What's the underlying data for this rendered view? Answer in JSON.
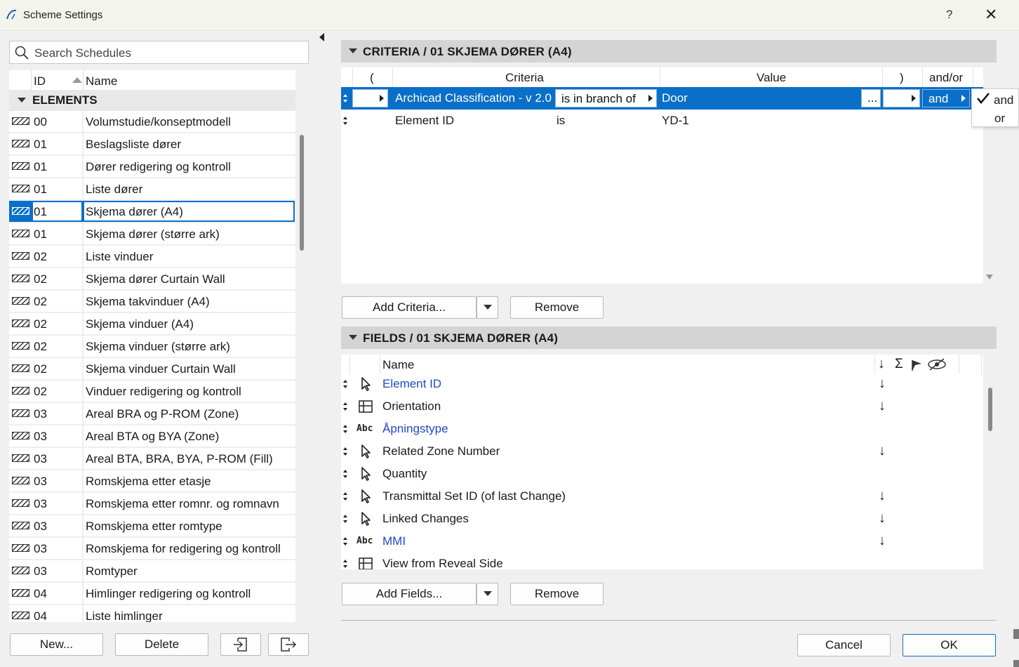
{
  "window": {
    "title": "Scheme Settings",
    "help_label": "?",
    "close_label": "✕"
  },
  "search": {
    "placeholder": "Search Schedules"
  },
  "list": {
    "header_id": "ID",
    "header_name": "Name",
    "group": "ELEMENTS",
    "items": [
      {
        "id": "00",
        "name": "Volumstudie/konseptmodell"
      },
      {
        "id": "01",
        "name": "Beslagsliste dører"
      },
      {
        "id": "01",
        "name": "Dører redigering og kontroll"
      },
      {
        "id": "01",
        "name": "Liste dører"
      },
      {
        "id": "01",
        "name": "Skjema dører (A4)"
      },
      {
        "id": "01",
        "name": "Skjema dører (større ark)"
      },
      {
        "id": "02",
        "name": "Liste vinduer"
      },
      {
        "id": "02",
        "name": "Skjema dører Curtain Wall"
      },
      {
        "id": "02",
        "name": "Skjema takvinduer (A4)"
      },
      {
        "id": "02",
        "name": "Skjema vinduer (A4)"
      },
      {
        "id": "02",
        "name": "Skjema vinduer (større ark)"
      },
      {
        "id": "02",
        "name": "Skjema vinduer Curtain Wall"
      },
      {
        "id": "02",
        "name": "Vinduer redigering og kontroll"
      },
      {
        "id": "03",
        "name": "Areal BRA og P-ROM (Zone)"
      },
      {
        "id": "03",
        "name": "Areal BTA og BYA (Zone)"
      },
      {
        "id": "03",
        "name": "Areal BTA, BRA, BYA, P-ROM (Fill)"
      },
      {
        "id": "03",
        "name": "Romskjema etter etasje"
      },
      {
        "id": "03",
        "name": "Romskjema etter romnr. og romnavn"
      },
      {
        "id": "03",
        "name": "Romskjema etter romtype"
      },
      {
        "id": "03",
        "name": "Romskjema for redigering og kontroll"
      },
      {
        "id": "03",
        "name": "Romtyper"
      },
      {
        "id": "04",
        "name": "Himlinger redigering og kontroll"
      },
      {
        "id": "04",
        "name": "Liste himlinger"
      }
    ]
  },
  "left_buttons": {
    "new": "New...",
    "delete": "Delete"
  },
  "criteria": {
    "title": "CRITERIA / 01 SKJEMA DØRER (A4)",
    "headers": {
      "open": "(",
      "criteria": "Criteria",
      "value": "Value",
      "close": ")",
      "andor": "and/or"
    },
    "rows": [
      {
        "criteria": "Archicad Classification - v 2.0",
        "operator": "is in branch of",
        "value": "Door",
        "more": "...",
        "andor": "and"
      },
      {
        "criteria": "Element ID",
        "operator": "is",
        "value": "YD-1"
      }
    ],
    "andor_options": [
      "and",
      "or"
    ],
    "add_label": "Add Criteria...",
    "remove_label": "Remove"
  },
  "fields": {
    "title": "FIELDS / 01 SKJEMA DØRER (A4)",
    "header_name": "Name",
    "header_sort": "↓",
    "header_sum": "Σ",
    "rows": [
      {
        "name": "Element ID",
        "icon": "pointer-icon",
        "link": true,
        "sort": "↓"
      },
      {
        "name": "Orientation",
        "icon": "grid-icon",
        "link": false,
        "sort": "↓"
      },
      {
        "name": "Åpningstype",
        "icon": "abc",
        "link": true,
        "sort": ""
      },
      {
        "name": "Related Zone Number",
        "icon": "pointer-icon",
        "link": false,
        "sort": "↓"
      },
      {
        "name": "Quantity",
        "icon": "pointer-icon",
        "link": false,
        "sort": ""
      },
      {
        "name": "Transmittal Set ID (of last Change)",
        "icon": "pointer-icon",
        "link": false,
        "sort": "↓"
      },
      {
        "name": "Linked Changes",
        "icon": "pointer-icon",
        "link": false,
        "sort": "↓"
      },
      {
        "name": "MMI",
        "icon": "abc",
        "link": true,
        "sort": "↓"
      },
      {
        "name": "View from Reveal Side",
        "icon": "grid-icon",
        "link": false,
        "sort": ""
      }
    ],
    "abc_label": "Abc",
    "add_label": "Add Fields...",
    "remove_label": "Remove"
  },
  "footer": {
    "cancel": "Cancel",
    "ok": "OK"
  },
  "colors": {
    "selection": "#0a6fc9",
    "link": "#1f49c7"
  }
}
